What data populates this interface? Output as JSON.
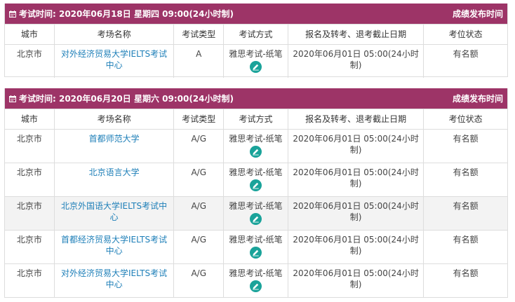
{
  "columns": [
    "城市",
    "考场名称",
    "考试类型",
    "考试方式",
    "报名及转考、退考截止日期",
    "考位状态"
  ],
  "sessions": [
    {
      "title": "考试时间: 2020年06月18日 星期四 09:00(24小时制)",
      "results_label": "成绩发布时间",
      "rows": [
        {
          "city": "北京市",
          "venue": "对外经济贸易大学IELTS考试中心",
          "type": "A",
          "mode": "雅思考试-纸笔",
          "deadline": "2020年06月01日 05:00(24小时制)",
          "status": "有名额"
        }
      ]
    },
    {
      "title": "考试时间: 2020年06月20日 星期六 09:00(24小时制)",
      "results_label": "成绩发布时间",
      "rows": [
        {
          "city": "北京市",
          "venue": "首都师范大学",
          "type": "A/G",
          "mode": "雅思考试-纸笔",
          "deadline": "2020年06月01日 05:00(24小时制)",
          "status": "有名额"
        },
        {
          "city": "北京市",
          "venue": "北京语言大学",
          "type": "A/G",
          "mode": "雅思考试-纸笔",
          "deadline": "2020年06月01日 05:00(24小时制)",
          "status": "有名额"
        },
        {
          "city": "北京市",
          "venue": "北京外国语大学IELTS考试中心",
          "type": "A/G",
          "mode": "雅思考试-纸笔",
          "deadline": "2020年06月01日 05:00(24小时制)",
          "status": "有名额"
        },
        {
          "city": "北京市",
          "venue": "首都经济贸易大学IELTS考试中心",
          "type": "A/G",
          "mode": "雅思考试-纸笔",
          "deadline": "2020年06月01日 05:00(24小时制)",
          "status": "有名额"
        },
        {
          "city": "北京市",
          "venue": "对外经济贸易大学IELTS考试中心",
          "type": "A/G",
          "mode": "雅思考试-纸笔",
          "deadline": "2020年06月01日 05:00(24小时制)",
          "status": "有名额"
        }
      ]
    }
  ],
  "icons": {
    "header": "calendar-icon",
    "mode_action": "pencil-icon"
  },
  "colors": {
    "header_bg": "#9d3467",
    "link": "#1e7fb8",
    "action": "#1aa39a"
  }
}
